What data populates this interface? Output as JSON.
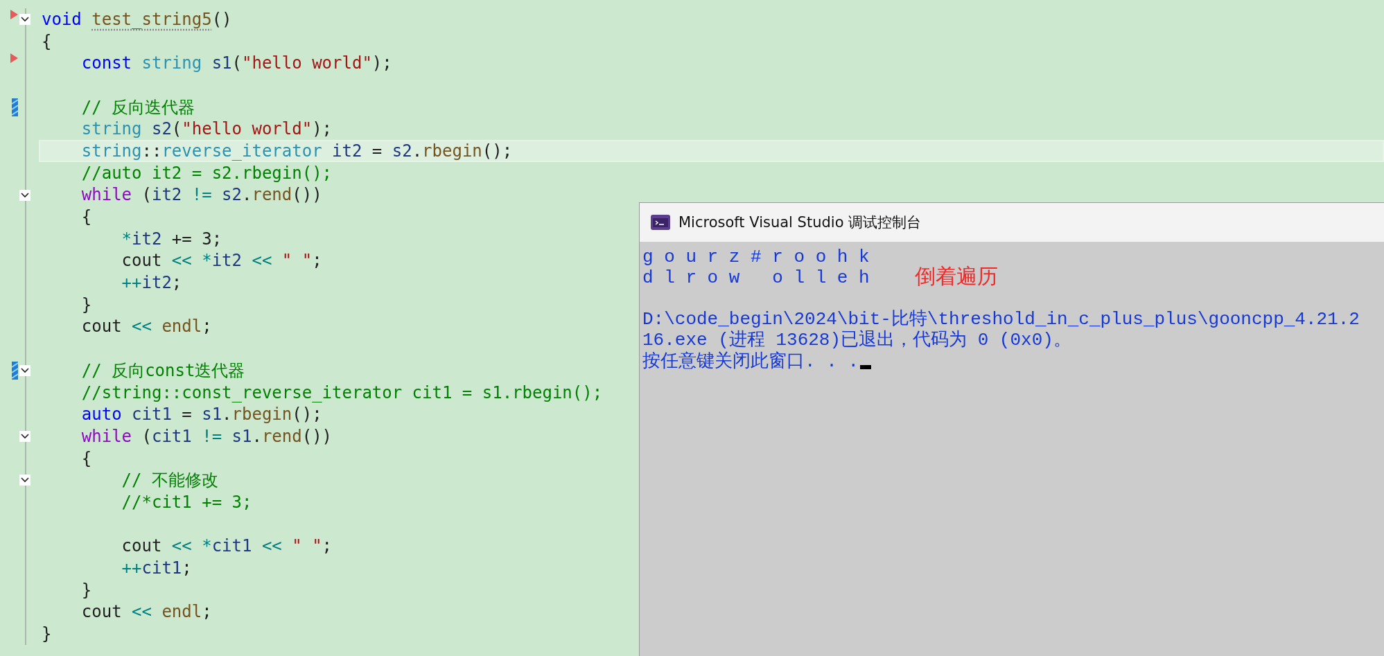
{
  "editor": {
    "lines": [
      {
        "marker": {
          "kind": "arrow"
        },
        "fold": true,
        "highlighted": false,
        "tokens": [
          {
            "text": "void ",
            "kind": "keyword"
          },
          {
            "text": "test_string5",
            "kind": "func-hint"
          },
          {
            "text": "()",
            "kind": "plain"
          }
        ]
      },
      {
        "fold": false,
        "highlighted": false,
        "tokens": [
          {
            "text": "{",
            "kind": "plain"
          }
        ]
      },
      {
        "marker": {
          "kind": "arrow"
        },
        "fold": false,
        "highlighted": false,
        "tokens": [
          {
            "text": "    const",
            "kind": "keyword"
          },
          {
            "text": " string",
            "kind": "type"
          },
          {
            "text": " s1",
            "kind": "ident"
          },
          {
            "text": "(",
            "kind": "plain"
          },
          {
            "text": "\"hello world\"",
            "kind": "string"
          },
          {
            "text": ");",
            "kind": "plain"
          }
        ]
      },
      {
        "fold": false,
        "highlighted": false
      },
      {
        "marker": {
          "kind": "change"
        },
        "fold": false,
        "highlighted": false,
        "tokens": [
          {
            "text": "    // 反向迭代器",
            "kind": "comment"
          }
        ]
      },
      {
        "fold": false,
        "highlighted": false,
        "tokens": [
          {
            "text": "    string",
            "kind": "type"
          },
          {
            "text": " s2",
            "kind": "ident"
          },
          {
            "text": "(",
            "kind": "plain"
          },
          {
            "text": "\"hello world\"",
            "kind": "string"
          },
          {
            "text": ");",
            "kind": "plain"
          }
        ]
      },
      {
        "fold": false,
        "highlighted": true,
        "tokens": [
          {
            "text": "    string",
            "kind": "type"
          },
          {
            "text": "::",
            "kind": "plain"
          },
          {
            "text": "reverse_iterator",
            "kind": "type"
          },
          {
            "text": " it2 ",
            "kind": "ident"
          },
          {
            "text": "=",
            "kind": "plain"
          },
          {
            "text": " s2",
            "kind": "ident"
          },
          {
            "text": ".",
            "kind": "plain"
          },
          {
            "text": "rbegin",
            "kind": "func"
          },
          {
            "text": "();",
            "kind": "plain"
          }
        ]
      },
      {
        "fold": false,
        "highlighted": false,
        "tokens": [
          {
            "text": "    //auto it2 = s2.rbegin();",
            "kind": "comment"
          }
        ]
      },
      {
        "fold": true,
        "highlighted": false,
        "tokens": [
          {
            "text": "    while",
            "kind": "control"
          },
          {
            "text": " (",
            "kind": "plain"
          },
          {
            "text": "it2 ",
            "kind": "ident"
          },
          {
            "text": "!=",
            "kind": "op"
          },
          {
            "text": " s2",
            "kind": "ident"
          },
          {
            "text": ".",
            "kind": "plain"
          },
          {
            "text": "rend",
            "kind": "func"
          },
          {
            "text": "())",
            "kind": "plain"
          }
        ]
      },
      {
        "fold": false,
        "highlighted": false,
        "tokens": [
          {
            "text": "    {",
            "kind": "plain"
          }
        ]
      },
      {
        "fold": false,
        "highlighted": false,
        "tokens": [
          {
            "text": "        *",
            "kind": "op"
          },
          {
            "text": "it2 ",
            "kind": "ident"
          },
          {
            "text": "+= 3;",
            "kind": "plain"
          }
        ]
      },
      {
        "fold": false,
        "highlighted": false,
        "tokens": [
          {
            "text": "        cout ",
            "kind": "plain"
          },
          {
            "text": "<< *",
            "kind": "op"
          },
          {
            "text": "it2 ",
            "kind": "ident"
          },
          {
            "text": "<< ",
            "kind": "op"
          },
          {
            "text": "\" \"",
            "kind": "string"
          },
          {
            "text": ";",
            "kind": "plain"
          }
        ]
      },
      {
        "fold": false,
        "highlighted": false,
        "tokens": [
          {
            "text": "        ++",
            "kind": "op"
          },
          {
            "text": "it2",
            "kind": "ident"
          },
          {
            "text": ";",
            "kind": "plain"
          }
        ]
      },
      {
        "fold": false,
        "highlighted": false,
        "tokens": [
          {
            "text": "    }",
            "kind": "plain"
          }
        ]
      },
      {
        "fold": false,
        "highlighted": false,
        "tokens": [
          {
            "text": "    cout ",
            "kind": "plain"
          },
          {
            "text": "<< ",
            "kind": "op"
          },
          {
            "text": "endl",
            "kind": "func"
          },
          {
            "text": ";",
            "kind": "plain"
          }
        ]
      },
      {
        "fold": false,
        "highlighted": false
      },
      {
        "marker": {
          "kind": "change"
        },
        "fold": true,
        "highlighted": false,
        "tokens": [
          {
            "text": "    // 反向const迭代器",
            "kind": "comment"
          }
        ]
      },
      {
        "fold": false,
        "highlighted": false,
        "tokens": [
          {
            "text": "    //string::const_reverse_iterator cit1 = s1.rbegin();",
            "kind": "comment"
          }
        ]
      },
      {
        "fold": false,
        "highlighted": false,
        "tokens": [
          {
            "text": "    auto",
            "kind": "keyword"
          },
          {
            "text": " cit1 ",
            "kind": "ident"
          },
          {
            "text": "=",
            "kind": "plain"
          },
          {
            "text": " s1",
            "kind": "ident"
          },
          {
            "text": ".",
            "kind": "plain"
          },
          {
            "text": "rbegin",
            "kind": "func"
          },
          {
            "text": "();",
            "kind": "plain"
          }
        ]
      },
      {
        "fold": true,
        "highlighted": false,
        "tokens": [
          {
            "text": "    while",
            "kind": "control"
          },
          {
            "text": " (",
            "kind": "plain"
          },
          {
            "text": "cit1 ",
            "kind": "ident"
          },
          {
            "text": "!=",
            "kind": "op"
          },
          {
            "text": " s1",
            "kind": "ident"
          },
          {
            "text": ".",
            "kind": "plain"
          },
          {
            "text": "rend",
            "kind": "func"
          },
          {
            "text": "())",
            "kind": "plain"
          }
        ]
      },
      {
        "fold": false,
        "highlighted": false,
        "tokens": [
          {
            "text": "    {",
            "kind": "plain"
          }
        ]
      },
      {
        "fold": true,
        "highlighted": false,
        "tokens": [
          {
            "text": "        // 不能修改",
            "kind": "comment"
          }
        ]
      },
      {
        "fold": false,
        "highlighted": false,
        "tokens": [
          {
            "text": "        //*cit1 += 3;",
            "kind": "comment"
          }
        ]
      },
      {
        "fold": false,
        "highlighted": false
      },
      {
        "fold": false,
        "highlighted": false,
        "tokens": [
          {
            "text": "        cout ",
            "kind": "plain"
          },
          {
            "text": "<< *",
            "kind": "op"
          },
          {
            "text": "cit1 ",
            "kind": "ident"
          },
          {
            "text": "<< ",
            "kind": "op"
          },
          {
            "text": "\" \"",
            "kind": "string"
          },
          {
            "text": ";",
            "kind": "plain"
          }
        ]
      },
      {
        "fold": false,
        "highlighted": false,
        "tokens": [
          {
            "text": "        ++",
            "kind": "op"
          },
          {
            "text": "cit1",
            "kind": "ident"
          },
          {
            "text": ";",
            "kind": "plain"
          }
        ]
      },
      {
        "fold": false,
        "highlighted": false,
        "tokens": [
          {
            "text": "    }",
            "kind": "plain"
          }
        ]
      },
      {
        "fold": false,
        "highlighted": false,
        "tokens": [
          {
            "text": "    cout ",
            "kind": "plain"
          },
          {
            "text": "<< ",
            "kind": "op"
          },
          {
            "text": "endl",
            "kind": "func"
          },
          {
            "text": ";",
            "kind": "plain"
          }
        ]
      },
      {
        "fold": false,
        "highlighted": false,
        "tokens": [
          {
            "text": "}",
            "kind": "plain"
          }
        ]
      }
    ]
  },
  "console": {
    "title": "Microsoft Visual Studio 调试控制台",
    "blocks": [
      [
        "g o u r z # r o o h k",
        "d l r o w   o l l e h"
      ],
      [
        "D:\\code_begin\\2024\\bit-比特\\threshold_in_c_plus_plus\\gooncpp_4.21.2",
        "16.exe (进程 13628)已退出，代码为 0 (0x0)。",
        "按任意键关闭此窗口. . ."
      ]
    ],
    "cursor": true,
    "annotation": "倒着遍历"
  }
}
